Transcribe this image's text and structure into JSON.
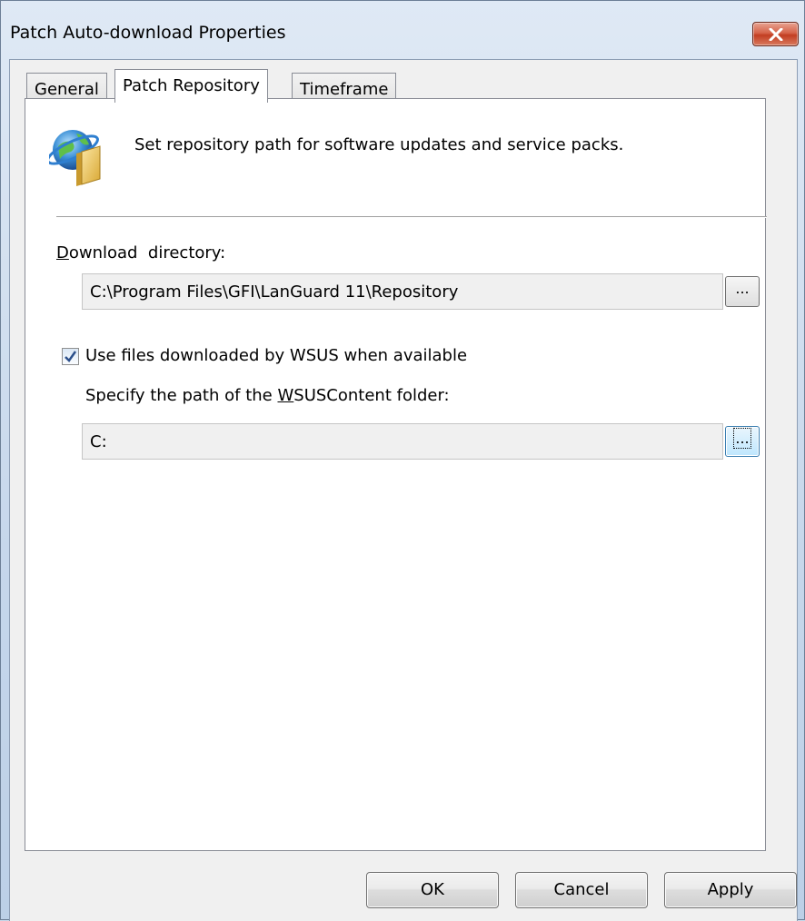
{
  "window": {
    "title": "Patch Auto-download Properties"
  },
  "tabs": [
    {
      "label": "General",
      "active": false
    },
    {
      "label": "Patch Repository",
      "active": true
    },
    {
      "label": "Timeframe",
      "active": false
    }
  ],
  "header": {
    "icon": "globe-folder-icon",
    "description": "Set repository path for software updates and service packs."
  },
  "download_directory": {
    "label_underlined": "D",
    "label_rest": "ownload  directory:",
    "value": "C:\\Program Files\\GFI\\LanGuard 11\\Repository",
    "browse_label": "..."
  },
  "wsus": {
    "checkbox_label": "Use files downloaded by WSUS when available",
    "checked": true,
    "path_label_before": "Specify the path of the ",
    "path_label_underlined": "W",
    "path_label_after": "SUSContent folder:",
    "value": "C:",
    "browse_label": "..."
  },
  "buttons": {
    "ok": "OK",
    "cancel": "Cancel",
    "apply": "Apply"
  },
  "colors": {
    "frame": "#c9d9ea",
    "close_button": "#c94a2e",
    "panel": "#ffffff",
    "dialog_face": "#f0f0f0"
  }
}
